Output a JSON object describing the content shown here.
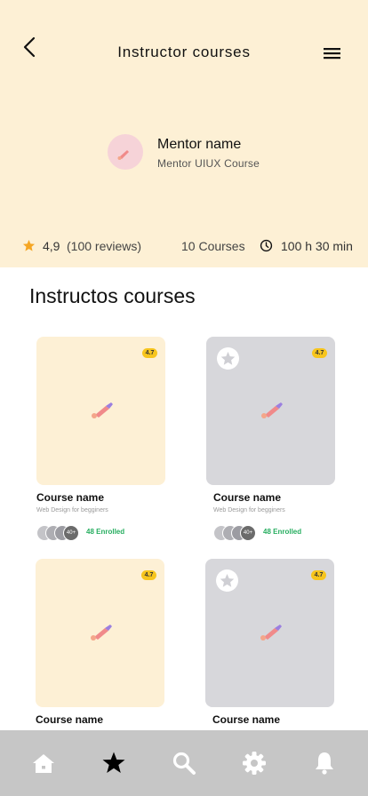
{
  "header": {
    "title": "Instructor courses",
    "mentor_name": "Mentor name",
    "mentor_course": "Mentor UIUX Course",
    "rating": "4,9",
    "reviews": "(100 reviews)",
    "courses_count": "10 Courses",
    "duration": "100 h 30 min"
  },
  "section": {
    "title": "Instructos courses"
  },
  "cards": [
    {
      "name": "Course name",
      "subtitle": "Web Design for begginers",
      "rating": "4.7",
      "enrolled": "48 Enrolled",
      "more": "40+"
    },
    {
      "name": "Course name",
      "subtitle": "Web Design for begginers",
      "rating": "4.7",
      "enrolled": "48 Enrolled",
      "more": "40+"
    },
    {
      "name": "Course name",
      "rating": "4.7"
    },
    {
      "name": "Course name",
      "rating": "4.7"
    }
  ],
  "nav": {
    "items": [
      "home-icon",
      "star-icon",
      "search-icon",
      "gear-icon",
      "bell-icon"
    ],
    "active": "star-icon"
  },
  "colors": {
    "header_bg": "#fdf0d5",
    "card_gray": "#d7d7db",
    "badge": "#f7c51d",
    "enrolled": "#27ae60",
    "nav_bg": "#c6c6c6"
  }
}
